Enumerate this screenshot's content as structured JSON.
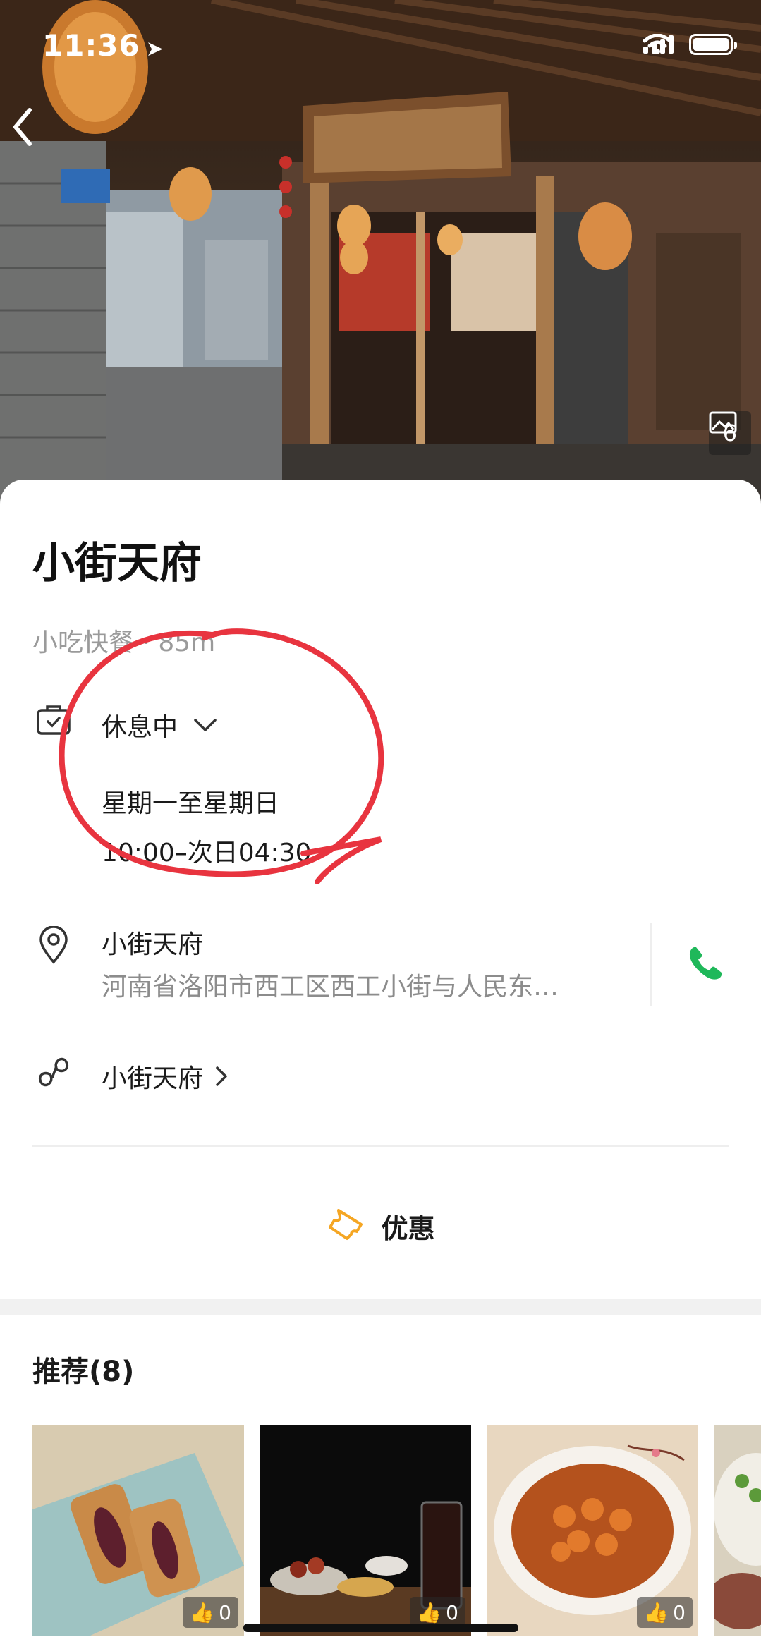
{
  "status_bar": {
    "time": "11:36"
  },
  "hero": {
    "photo_count": "6"
  },
  "place": {
    "name": "小街天府",
    "category_distance": "小吃快餐 · 85m"
  },
  "hours": {
    "status": "休息中",
    "days": "星期一至星期日",
    "time": "10:00–次日04:30"
  },
  "address": {
    "name": "小街天府",
    "line": "河南省洛阳市西工区西工小街与人民东…"
  },
  "mini_program": {
    "label": "小街天府"
  },
  "coupon": {
    "label": "优惠"
  },
  "recommend": {
    "title": "推荐(8)",
    "items": [
      {
        "likes": "0"
      },
      {
        "likes": "0"
      },
      {
        "likes": "0"
      },
      {
        "likes": ""
      }
    ]
  },
  "colors": {
    "accent_green": "#1fb85a",
    "coupon_orange": "#f5a623",
    "annotation_red": "#e8343f"
  }
}
